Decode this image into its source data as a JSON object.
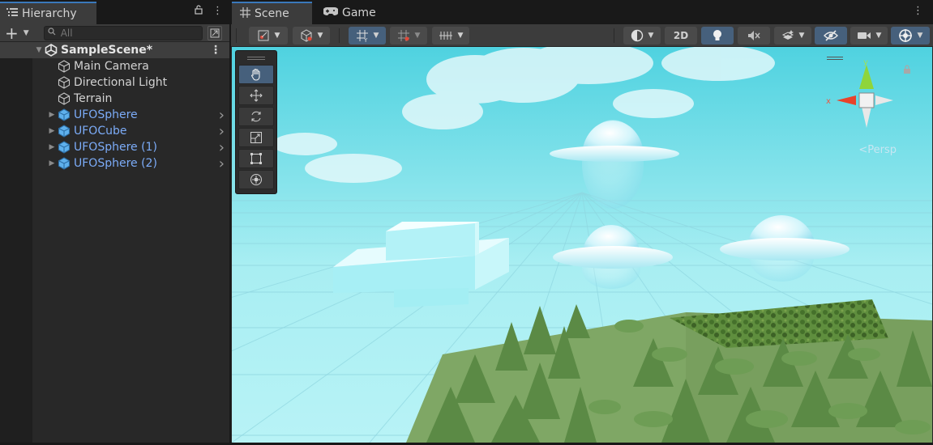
{
  "hierarchy": {
    "tab_title": "Hierarchy",
    "search_placeholder": "All",
    "scene": {
      "name": "SampleScene*"
    },
    "items": [
      {
        "label": "Main Camera",
        "prefab": false
      },
      {
        "label": "Directional Light",
        "prefab": false
      },
      {
        "label": "Terrain",
        "prefab": false
      },
      {
        "label": "UFOSphere",
        "prefab": true
      },
      {
        "label": "UFOCube",
        "prefab": true
      },
      {
        "label": "UFOSphere (1)",
        "prefab": true
      },
      {
        "label": "UFOSphere (2)",
        "prefab": true
      }
    ]
  },
  "scene_view": {
    "tabs": [
      {
        "label": "Scene",
        "icon": "grid-icon",
        "active": true
      },
      {
        "label": "Game",
        "icon": "gamepad-icon",
        "active": false
      }
    ],
    "toolbar": {
      "toggle_2d": "2D"
    },
    "tools": [
      "hand-tool",
      "move-tool",
      "rotate-tool",
      "scale-tool",
      "rect-tool",
      "transform-tool"
    ],
    "gizmo": {
      "y_label": "y",
      "x_label": "x",
      "projection": "Persp"
    }
  },
  "colors": {
    "accent": "#3a79bb",
    "prefab_text": "#7cacf8",
    "sky": "#64d6e0",
    "ground": "#7aa064"
  }
}
